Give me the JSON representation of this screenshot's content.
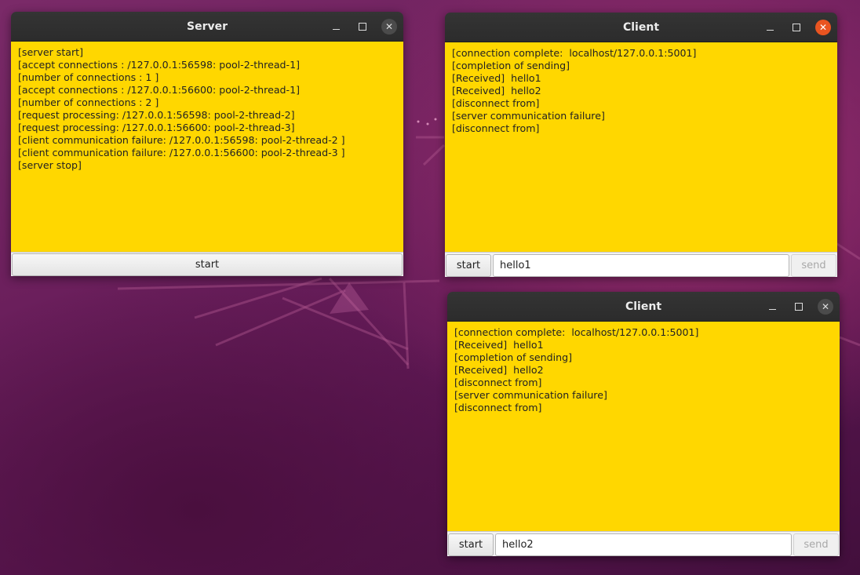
{
  "server_window": {
    "title": "Server",
    "log_lines": [
      "[server start]",
      "[accept connections : /127.0.0.1:56598: pool-2-thread-1]",
      "[number of connections : 1 ]",
      "[accept connections : /127.0.0.1:56600: pool-2-thread-1]",
      "[number of connections : 2 ]",
      "[request processing: /127.0.0.1:56598: pool-2-thread-2]",
      "[request processing: /127.0.0.1:56600: pool-2-thread-3]",
      "[client communication failure: /127.0.0.1:56598: pool-2-thread-2 ]",
      "[client communication failure: /127.0.0.1:56600: pool-2-thread-3 ]",
      "[server stop]"
    ],
    "start_label": "start"
  },
  "client_window_1": {
    "title": "Client",
    "log_lines": [
      "[connection complete:  localhost/127.0.0.1:5001]",
      "[completion of sending]",
      "[Received]  hello1",
      "[Received]  hello2",
      "[disconnect from]",
      "[server communication failure]",
      "[disconnect from]"
    ],
    "start_label": "start",
    "message_value": "hello1",
    "send_label": "send"
  },
  "client_window_2": {
    "title": "Client",
    "log_lines": [
      "[connection complete:  localhost/127.0.0.1:5001]",
      "[Received]  hello1",
      "[completion of sending]",
      "[Received]  hello2",
      "[disconnect from]",
      "[server communication failure]",
      "[disconnect from]"
    ],
    "start_label": "start",
    "message_value": "hello2",
    "send_label": "send"
  },
  "window_controls": {
    "minimize_icon": "minimize-icon",
    "maximize_icon": "maximize-icon",
    "close_icon": "close-icon",
    "close_glyph": "✕"
  },
  "colors": {
    "log_background": "#ffd700",
    "titlebar": "#2c2c2c",
    "close_active": "#e95420",
    "desktop": "#6b1f5c"
  }
}
